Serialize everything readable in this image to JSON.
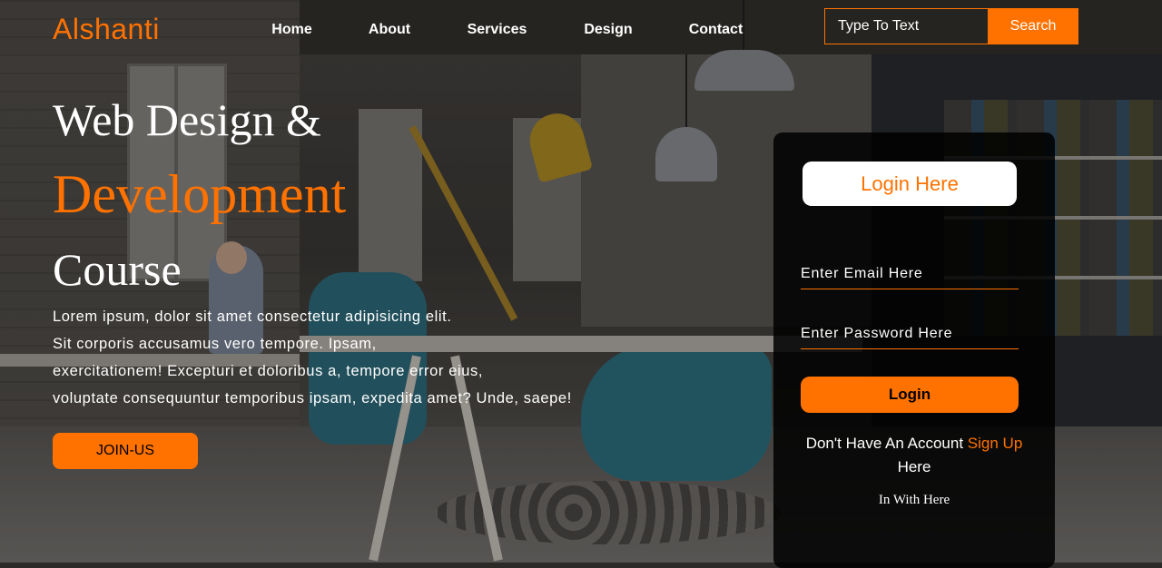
{
  "brand": {
    "name": "Alshanti",
    "accent_color": "#ff7200"
  },
  "nav": {
    "items": [
      {
        "label": "Home"
      },
      {
        "label": "About"
      },
      {
        "label": "Services"
      },
      {
        "label": "Design"
      },
      {
        "label": "Contact"
      }
    ]
  },
  "search": {
    "placeholder": "Type To Text",
    "button_label": "Search"
  },
  "hero": {
    "line1": "Web Design &",
    "line2": "Development",
    "line3": "Course",
    "paragraph_lines": [
      "Lorem ipsum, dolor sit amet consectetur adipisicing elit.",
      "Sit corporis accusamus vero tempore. Ipsam,",
      "exercitationem! Excepturi et doloribus a, tempore error eius,",
      "voluptate consequuntur temporibus ipsam, expedita amet? Unde, saepe!"
    ],
    "join_label": "JOIN-US"
  },
  "login": {
    "title": "Login Here",
    "email_placeholder": "Enter Email Here",
    "password_placeholder": "Enter Password Here",
    "button_label": "Login",
    "account_prefix": "Don't Have An Account",
    "signup_label": "Sign Up",
    "account_suffix": "Here",
    "social_text": "In With Here"
  }
}
